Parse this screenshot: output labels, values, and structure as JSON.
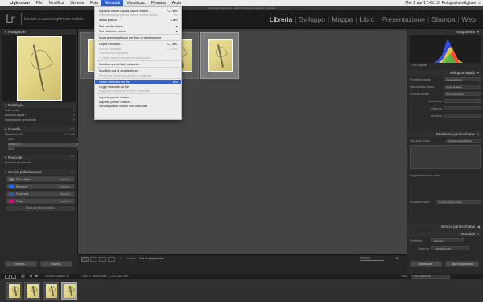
{
  "macbar": {
    "apple": "",
    "menus": [
      "Lightroom",
      "File",
      "Modifica",
      "Libreria",
      "Foto",
      "Metadati",
      "Visualizza",
      "Finestra",
      "Aiuto"
    ],
    "active_menu": "Metadati",
    "clock": "Mer 1 apr  17:43:13",
    "user": "FotografiaIndigitale"
  },
  "window_title": "Fotografia MacroLirica - Adobe Photoshop Lightroom - Libreria",
  "identity": {
    "logo": "Lr",
    "text": "Iniziate a usare Lightroom mobile"
  },
  "modules": [
    {
      "label": "Libreria",
      "active": true
    },
    {
      "label": "Sviluppo",
      "active": false
    },
    {
      "label": "Mappa",
      "active": false
    },
    {
      "label": "Libro",
      "active": false
    },
    {
      "label": "Presentazione",
      "active": false
    },
    {
      "label": "Stampa",
      "active": false
    },
    {
      "label": "Web",
      "active": false
    }
  ],
  "left_panel": {
    "navigator": "Navigatore",
    "navigator_zoom": "ADATTA  RIEMPI  1:1  3:1",
    "catalog": {
      "title": "Catalogo",
      "rows": [
        {
          "label": "Tutte le foto",
          "count": "3"
        },
        {
          "label": "Raccolta rapida +",
          "count": "0"
        },
        {
          "label": "Importazione precedente",
          "count": "3"
        }
      ]
    },
    "folders": {
      "title": "Cartelle",
      "volume": "Macintosh HD",
      "volume_info": "4 / 4 GB",
      "rows": [
        {
          "label": "2015",
          "count": "3"
        },
        {
          "label": "cataloo 19",
          "count": "3"
        },
        {
          "label": "2016",
          "count": "0"
        }
      ]
    },
    "collections": {
      "title": "Raccolte",
      "rows": [
        {
          "label": "Raccolte dei percorsi",
          "count": ""
        }
      ]
    },
    "publish": {
      "title": "Servizi pubblicazione",
      "services": [
        {
          "label": "Disco rigido",
          "action": "Imposta...",
          "color": "#777"
        },
        {
          "label": "Behance",
          "action": "Imposta...",
          "color": "#1769ff"
        },
        {
          "label": "Facebook",
          "action": "Imposta...",
          "color": "#3b5998"
        },
        {
          "label": "Flickr",
          "action": "Imposta...",
          "color": "#e0007a"
        }
      ],
      "more": "Trova più servizi online..."
    },
    "import_btn": "Importa...",
    "export_btn": "Esporta..."
  },
  "grid": {
    "toolbar_label": "Ordina:",
    "toolbar_value": "Ora di acquisizione",
    "thumbs_label": "Miniature"
  },
  "right_panel": {
    "histogram": "Istogramma",
    "histogram_info": "Foto originale",
    "quick_develop": "Sviluppo rapido",
    "qd_rows": [
      {
        "label": "Predefinito salvato",
        "value": "Personalizzato"
      },
      {
        "label": "Bilanciamento bianco",
        "value": "Come scattato"
      },
      {
        "label": "Controllo tonalità",
        "value": "Tono automatico"
      },
      {
        "label": "Esposizione",
        "value": ""
      },
      {
        "label": "Chiarezza",
        "value": ""
      },
      {
        "label": "Vividezza",
        "value": ""
      }
    ],
    "keywording": "Creazione parole chiave",
    "kw_tags_label": "Tag parole chiave",
    "kw_tags_value": "Immetti parole chiave",
    "kw_suggest": "Suggerimenti parole chiave",
    "kw_set_label": "Set parole chiave",
    "kw_set_value": "Recenti parole chiave",
    "kw_list": "Elenco parole chiave",
    "metadata": "Metadati",
    "md_preset_label": "Predefinito",
    "md_preset_value": "Nessuno",
    "md_rows": [
      {
        "label": "Nome file",
        "value": "_DSC3062.NEF"
      },
      {
        "label": "Cartella",
        "value": "cataloo 19"
      }
    ],
    "sync_btn": "Sincronizza",
    "sync_settings_btn": "Sincr. impostazioni"
  },
  "filmstrip": {
    "pages": [
      "1",
      "2"
    ],
    "path_label": "Cartella: cataloo 19",
    "selection": "4 foto / 1 selezionate / _DSC3062.NEF",
    "filter_label": "Filtro:",
    "filter_value": "Filtri disattivati"
  },
  "menu": {
    "items": [
      {
        "label": "Imposta scelta rapida parola chiave...",
        "shortcut": "⌥⇧⌘K",
        "state": "normal"
      },
      {
        "label": "Attiva/disattiva parola chiave scelta rapida",
        "shortcut": "⇧K",
        "state": "disabled"
      },
      {
        "label": "Attiva pittura",
        "shortcut": "⌥⌘K",
        "state": "normal"
      },
      {
        "sep": true
      },
      {
        "label": "Set parole chiave",
        "shortcut": "▸",
        "state": "normal"
      },
      {
        "label": "Set etichette colore",
        "shortcut": "▸",
        "state": "normal"
      },
      {
        "sep": true
      },
      {
        "label": "Mostra metadati solo per foto di destinazione",
        "shortcut": "",
        "state": "normal"
      },
      {
        "sep": true
      },
      {
        "label": "Copia metadati...",
        "shortcut": "⌥⇧⌘C",
        "state": "normal"
      },
      {
        "label": "Incolla metadati",
        "shortcut": "⌥⇧⌘V",
        "state": "disabled"
      },
      {
        "label": "Sincronizza metadati",
        "shortcut": "",
        "state": "disabled"
      },
      {
        "label": "✓ Attiva sincronizzazione automatica",
        "shortcut": "",
        "state": "disabled"
      },
      {
        "sep": true
      },
      {
        "label": "Modifica predefiniti metadati...",
        "shortcut": "",
        "state": "normal"
      },
      {
        "sep": true
      },
      {
        "label": "Modifica ora di acquisizione...",
        "shortcut": "",
        "state": "normal"
      },
      {
        "label": "Ripristina ora di acquisizione originale",
        "shortcut": "",
        "state": "disabled"
      },
      {
        "sep": true
      },
      {
        "label": "Salva metadati nel file",
        "shortcut": "⌘S",
        "state": "highlight"
      },
      {
        "label": "Leggi metadati da file",
        "shortcut": "",
        "state": "normal"
      },
      {
        "label": "Aggiorna anteprima DNG e metadati",
        "shortcut": "",
        "state": "disabled"
      },
      {
        "sep": true
      },
      {
        "label": "Importa parole chiave...",
        "shortcut": "",
        "state": "normal"
      },
      {
        "label": "Esporta parole chiave...",
        "shortcut": "",
        "state": "normal"
      },
      {
        "label": "Svuota parole chiave non utilizzate",
        "shortcut": "",
        "state": "normal"
      }
    ]
  },
  "colors": {
    "accent": "#2d63d8",
    "panel": "#2a2a2a",
    "grid": "#444444"
  }
}
